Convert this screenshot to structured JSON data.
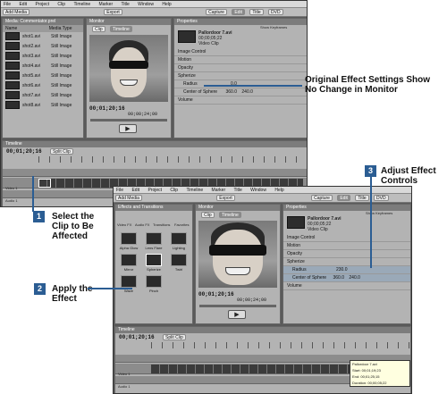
{
  "menu": [
    "File",
    "Edit",
    "Project",
    "Clip",
    "Timeline",
    "Marker",
    "Title",
    "Window",
    "Help"
  ],
  "toolbar": {
    "add_media": "Add Media",
    "export": "Export",
    "tabs": [
      "Capture",
      "Edit",
      "Title",
      "DVD"
    ]
  },
  "media_panel": {
    "title": "Media: Commentator.prel",
    "col_name": "Name",
    "col_type": "Media Type",
    "items": [
      {
        "name": "shot1.avi",
        "type": "Still Image"
      },
      {
        "name": "shot2.avi",
        "type": "Still Image"
      },
      {
        "name": "shot3.avi",
        "type": "Still Image"
      },
      {
        "name": "shot4.avi",
        "type": "Still Image"
      },
      {
        "name": "shot5.avi",
        "type": "Still Image"
      },
      {
        "name": "shot6.avi",
        "type": "Still Image"
      },
      {
        "name": "shot7.avi",
        "type": "Still Image"
      },
      {
        "name": "shot8.avi",
        "type": "Still Image"
      }
    ]
  },
  "monitor": {
    "title": "Monitor",
    "clip_tab": "Clip",
    "timeline_tab": "Timeline",
    "timecode": "00;01;20;16",
    "duration": "00;00;24;00"
  },
  "properties": {
    "title": "Properties",
    "clip_name": "Pallordoor 7.avi",
    "clip_info": "00;00;05;22",
    "clip_type": "Video Clip",
    "show_keyframes": "Show Keyframes",
    "rows": [
      "Image Control",
      "Motion",
      "Opacity",
      "Spherize",
      "Radius",
      "Center of Sphere",
      "Volume"
    ],
    "radius_before": "0.0",
    "center_before": [
      "360.0",
      "240.0"
    ],
    "radius_after": "230.0",
    "center_after": [
      "360.0",
      "240.0"
    ]
  },
  "timeline": {
    "title": "Timeline",
    "timecode": "00;01;20;16",
    "split_clip": "Split Clip",
    "tracks": [
      "DVD Marker",
      "Video 1",
      "Audio 1"
    ]
  },
  "effects_panel": {
    "title": "Effects and Transitions",
    "buttons": [
      "Video FX",
      "Audio FX",
      "Transitions",
      "Favorites"
    ],
    "effects": [
      "Alpha Glow",
      "Lens Flare",
      "Lighting",
      "Mirror",
      "Spherize",
      "Twirl",
      "Wave",
      "Pinch"
    ]
  },
  "tooltip": {
    "name": "Pallordoor 7.avi",
    "start": "Start: 00;01;19;23",
    "end": "End: 00;01;25;15",
    "duration": "Duration: 00;00;05;22"
  },
  "callouts": {
    "original": "Original Effect Settings Show No Change in Monitor",
    "step1_num": "1",
    "step1": "Select the Clip to Be Affected",
    "step2_num": "2",
    "step2": "Apply the Effect",
    "step3_num": "3",
    "step3": "Adjust Effect Controls"
  },
  "colors": {
    "callout_blue": "#2b5d93",
    "highlight_row": "#9aa9b8"
  }
}
